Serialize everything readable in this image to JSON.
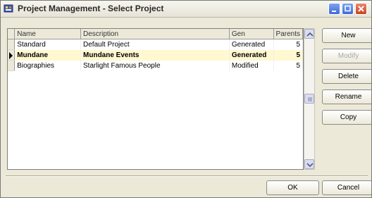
{
  "window": {
    "title": "Project Management - Select Project",
    "icon": "project-icon"
  },
  "table": {
    "columns": [
      {
        "key": "name",
        "label": "Name"
      },
      {
        "key": "description",
        "label": "Description"
      },
      {
        "key": "gen",
        "label": "Gen"
      },
      {
        "key": "parents",
        "label": "Parents"
      }
    ],
    "rows": [
      {
        "name": "Standard",
        "description": "Default Project",
        "gen": "Generated",
        "parents": "5"
      },
      {
        "name": "Mundane",
        "description": "Mundane Events",
        "gen": "Generated",
        "parents": "5",
        "current": true
      },
      {
        "name": "Biographies",
        "description": "Starlight Famous People",
        "gen": "Modified",
        "parents": "5"
      }
    ]
  },
  "buttons": {
    "new": "New",
    "modify": "Modify",
    "delete": "Delete",
    "rename": "Rename",
    "copy": "Copy",
    "ok": "OK",
    "cancel": "Cancel"
  },
  "colors": {
    "selected_row": "#fff8d0",
    "face": "#ece9d8",
    "close": "#c9411f",
    "caption_blue": "#3e6ad6"
  }
}
